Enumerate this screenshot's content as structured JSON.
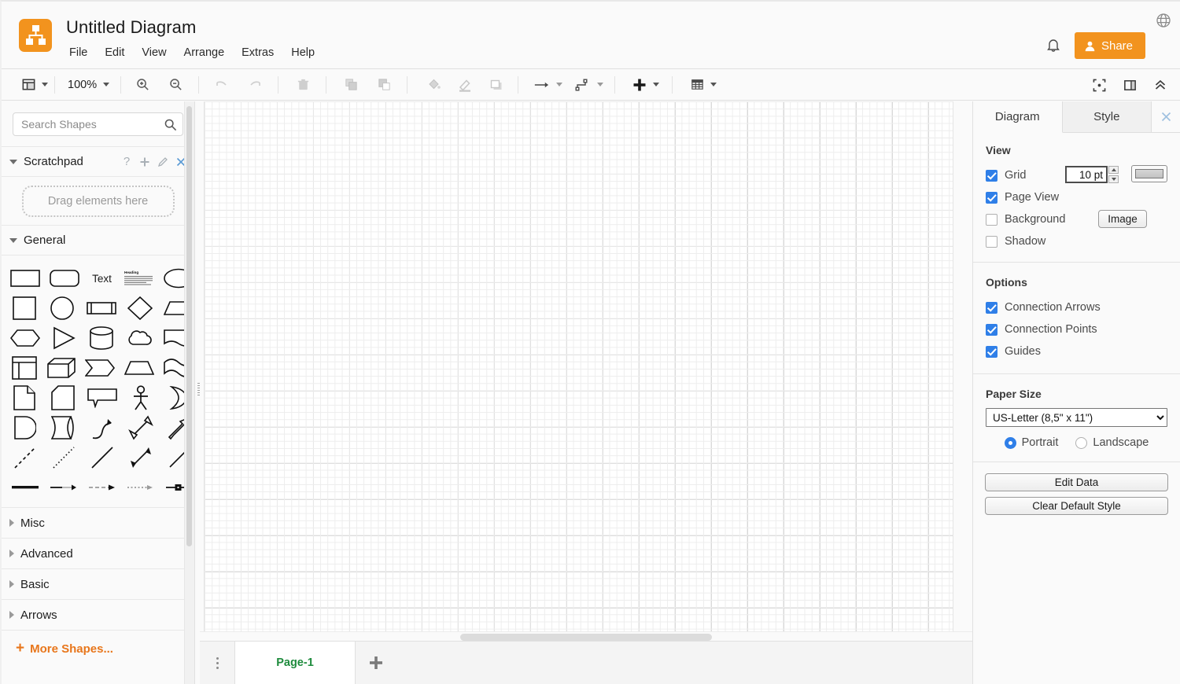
{
  "header": {
    "title": "Untitled Diagram",
    "logo_icon": "diagrams-net-logo-icon",
    "menu": [
      {
        "label": "File"
      },
      {
        "label": "Edit"
      },
      {
        "label": "View"
      },
      {
        "label": "Arrange"
      },
      {
        "label": "Extras"
      },
      {
        "label": "Help"
      }
    ],
    "globe_icon": "globe-icon",
    "bell_icon": "bell-icon",
    "share_label": "Share",
    "share_color": "#f2931e"
  },
  "toolbar": {
    "view_icon": "layout-panel-icon",
    "zoom_level": "100%",
    "zoom_in_icon": "zoom-in-icon",
    "zoom_out_icon": "zoom-out-icon",
    "undo_icon": "undo-icon",
    "redo_icon": "redo-icon",
    "delete_icon": "trash-icon",
    "to_front_icon": "bring-to-front-icon",
    "to_back_icon": "send-to-back-icon",
    "fill_icon": "fill-color-icon",
    "line_icon": "line-color-icon",
    "shadow_icon": "shadow-icon",
    "waypoints_icon": "connection-arrow-icon",
    "connection_icon": "waypoints-icon",
    "insert_icon": "plus-icon",
    "table_icon": "table-icon",
    "fit_page_icon": "fit-page-icon",
    "format_panel_icon": "format-panel-icon",
    "collapse_icon": "chevron-up-icon"
  },
  "sidebar": {
    "search_placeholder": "Search Shapes",
    "search_value": "",
    "search_icon": "search-icon",
    "scratchpad": {
      "label": "Scratchpad",
      "help_icon": "question-mark-icon",
      "add_icon": "plus-icon",
      "edit_icon": "pencil-icon",
      "close_icon": "close-icon",
      "drop_hint": "Drag elements here"
    },
    "general": {
      "label": "General",
      "shape_text": "Text",
      "shape_heading": "Heading",
      "shapes": [
        [
          "rectangle",
          "rounded-rectangle",
          "text",
          "textbox-heading",
          "ellipse"
        ],
        [
          "square",
          "circle",
          "process",
          "diamond",
          "parallelogram"
        ],
        [
          "hexagon",
          "triangle",
          "cylinder",
          "cloud",
          "document"
        ],
        [
          "internal-storage",
          "cube",
          "step",
          "trapezoid",
          "tape"
        ],
        [
          "note",
          "card",
          "callout",
          "actor",
          "or-shape"
        ],
        [
          "delay",
          "data-storage",
          "curved-arrow",
          "bidirectional-arrow",
          "block-arrow"
        ],
        [
          "dashed-line",
          "dotted-line",
          "line",
          "bidirectional-connector",
          "directional-connector"
        ],
        [
          "thick-line",
          "link-arrow",
          "dashed-arrow",
          "dotted-arrow",
          "labeled-arrow"
        ]
      ]
    },
    "sections": [
      {
        "label": "Misc"
      },
      {
        "label": "Advanced"
      },
      {
        "label": "Basic"
      },
      {
        "label": "Arrows"
      }
    ],
    "more_shapes": "More Shapes...",
    "more_shapes_color": "#e8761b"
  },
  "tabbar": {
    "page_menu_icon": "vertical-dots-icon",
    "pages": [
      {
        "label": "Page-1",
        "active": true
      }
    ],
    "add_page_icon": "plus-icon",
    "page_tab_color": "#1e8b3d"
  },
  "right_panel": {
    "tabs": [
      {
        "label": "Diagram",
        "active": true
      },
      {
        "label": "Style",
        "active": false
      }
    ],
    "close_icon": "close-icon",
    "view": {
      "title": "View",
      "grid": {
        "label": "Grid",
        "checked": true,
        "size": "10 pt",
        "color_swatch": "#c9c9c9"
      },
      "page_view": {
        "label": "Page View",
        "checked": true
      },
      "background": {
        "label": "Background",
        "checked": false,
        "button": "Image"
      },
      "shadow": {
        "label": "Shadow",
        "checked": false
      }
    },
    "options": {
      "title": "Options",
      "items": [
        {
          "label": "Connection Arrows",
          "checked": true
        },
        {
          "label": "Connection Points",
          "checked": true
        },
        {
          "label": "Guides",
          "checked": true
        }
      ]
    },
    "paper": {
      "title": "Paper Size",
      "selected": "US-Letter (8,5\" x 11\")",
      "orientation": [
        {
          "label": "Portrait",
          "selected": true
        },
        {
          "label": "Landscape",
          "selected": false
        }
      ]
    },
    "actions": [
      {
        "label": "Edit Data"
      },
      {
        "label": "Clear Default Style"
      }
    ]
  }
}
